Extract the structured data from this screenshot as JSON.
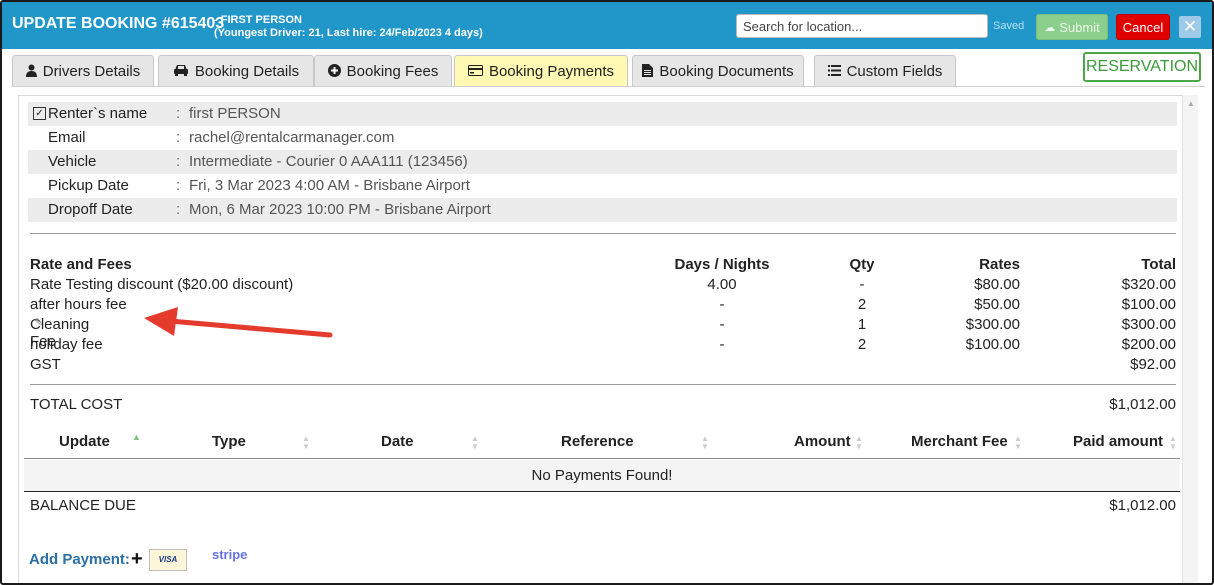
{
  "header": {
    "title": "UPDATE BOOKING #615403",
    "subtitle_line1": "- FIRST PERSON",
    "subtitle_line2": "(Youngest Driver: 21, Last hire: 24/Feb/2023 4 days)",
    "search_placeholder": "Search for location...",
    "saved_label": "Saved",
    "submit_label": "Submit",
    "cancel_label": "Cancel",
    "close_symbol": "✕",
    "submit_icon": "cloud-upload-icon"
  },
  "tabs": [
    {
      "label": "Drivers Details",
      "icon": "user-icon",
      "glyph": "👤",
      "active": false
    },
    {
      "label": "Booking Details",
      "icon": "car-icon",
      "glyph": "🚗",
      "active": false
    },
    {
      "label": "Booking Fees",
      "icon": "plus-circle-icon",
      "glyph": "⊕",
      "active": false
    },
    {
      "label": "Booking Payments",
      "icon": "credit-card-icon",
      "glyph": "▭",
      "active": true
    },
    {
      "label": "Booking Documents",
      "icon": "document-icon",
      "glyph": "▤",
      "active": false
    },
    {
      "label": "Custom Fields",
      "icon": "list-icon",
      "glyph": "☰",
      "active": false
    }
  ],
  "reservation_label": "RESERVATION",
  "renter": {
    "checkbox_mark": "✓",
    "rows": [
      {
        "label": "Renter`s name",
        "value": "first PERSON"
      },
      {
        "label": "Email",
        "value": "rachel@rentalcarmanager.com"
      },
      {
        "label": "Vehicle",
        "value": "Intermediate - Courier 0 AAA111 (123456)"
      },
      {
        "label": "Pickup Date",
        "value": "Fri, 3 Mar 2023 4:00 AM - Brisbane Airport"
      },
      {
        "label": "Dropoff Date",
        "value": "Mon, 6 Mar 2023 10:00 PM - Brisbane Airport"
      }
    ],
    "colon": ":"
  },
  "fees": {
    "headers": {
      "name": "Rate and Fees",
      "days": "Days / Nights",
      "qty": "Qty",
      "rates": "Rates",
      "total": "Total"
    },
    "rows": [
      {
        "name": "Rate Testing discount ($20.00 discount)",
        "days": "4.00",
        "qty": "-",
        "rate": "$80.00",
        "total": "$320.00",
        "edit": false
      },
      {
        "name": "after hours fee",
        "days": "-",
        "qty": "2",
        "rate": "$50.00",
        "total": "$100.00",
        "edit": false
      },
      {
        "name": "Cleaning Fee",
        "days": "-",
        "qty": "1",
        "rate": "$300.00",
        "total": "$300.00",
        "edit": true
      },
      {
        "name": "holiday fee",
        "days": "-",
        "qty": "2",
        "rate": "$100.00",
        "total": "$200.00",
        "edit": false
      },
      {
        "name": "GST",
        "days": "",
        "qty": "",
        "rate": "",
        "total": "$92.00",
        "edit": false
      }
    ],
    "pencil_glyph": "✎",
    "total_cost_label": "TOTAL COST",
    "total_cost_value": "$1,012.00"
  },
  "payments": {
    "columns": [
      "Update",
      "Type",
      "Date",
      "Reference",
      "Amount",
      "Merchant Fee",
      "Paid amount"
    ],
    "sort_glyph_asc": "▲",
    "sort_glyph": "▲▼",
    "empty_message": "No Payments Found!",
    "balance_label": "BALANCE DUE",
    "balance_value": "$1,012.00",
    "add_label": "Add Payment:",
    "plus_glyph": "+",
    "visa_label": "VISA",
    "stripe_label": "stripe"
  },
  "annotation_color": "#e53b2c"
}
